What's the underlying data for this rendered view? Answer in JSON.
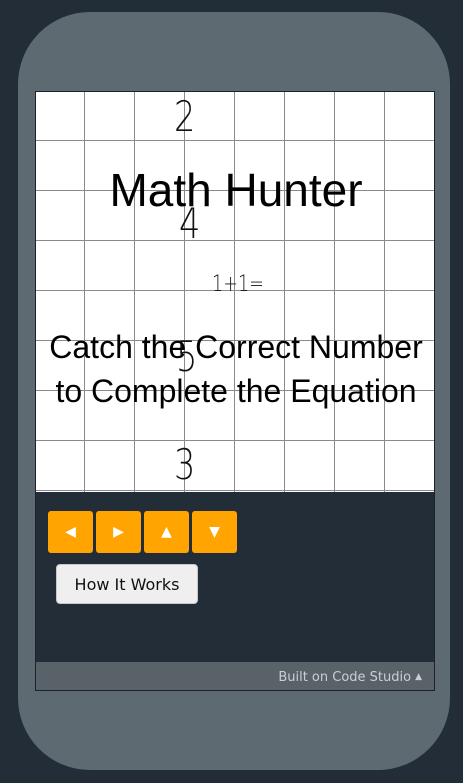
{
  "game": {
    "title": "Math Hunter",
    "subtitle": "Catch the Correct Number to Complete the Equation",
    "equation": "1+1=",
    "falling_numbers": [
      "2",
      "4",
      "5",
      "3"
    ]
  },
  "controls": {
    "left_icon": "◀",
    "right_icon": "▶",
    "up_icon": "▲",
    "down_icon": "▼",
    "how_it_works_label": "How It Works"
  },
  "footer": {
    "label": "Built on Code Studio",
    "caret_icon": "▲"
  },
  "colors": {
    "background": "#232d38",
    "frame": "#5e6a72",
    "arrow_button": "#ffa400",
    "grid_line": "#8a8a8a"
  }
}
